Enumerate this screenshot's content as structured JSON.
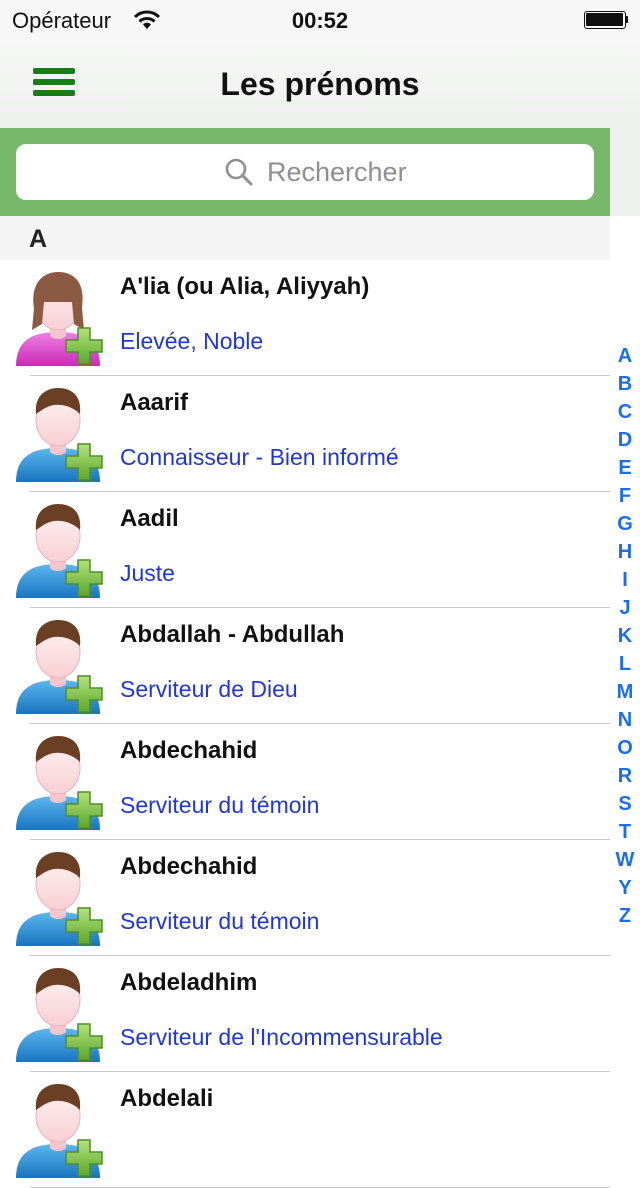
{
  "status_bar": {
    "carrier": "Opérateur",
    "time": "00:52"
  },
  "nav": {
    "title": "Les prénoms",
    "menu_icon": "hamburger-menu-icon"
  },
  "search": {
    "placeholder": "Rechercher"
  },
  "section": {
    "letter": "A"
  },
  "colors": {
    "accent_green": "#167d17",
    "search_bar_green": "#77b96b",
    "meaning_blue": "#2136d6",
    "index_blue": "#1a6ee8",
    "female_pink": "#e64fd2",
    "male_blue": "#2b8fd6",
    "plus_green": "#7ac143"
  },
  "names": [
    {
      "name": "A'lia (ou Alia, Aliyyah)",
      "meaning": "Elevée, Noble",
      "gender": "female"
    },
    {
      "name": "Aaarif",
      "meaning": "Connaisseur - Bien informé",
      "gender": "male"
    },
    {
      "name": "Aadil",
      "meaning": "Juste",
      "gender": "male"
    },
    {
      "name": "Abdallah - Abdullah",
      "meaning": "Serviteur de Dieu",
      "gender": "male"
    },
    {
      "name": "Abdechahid",
      "meaning": "Serviteur du témoin",
      "gender": "male"
    },
    {
      "name": "Abdechahid",
      "meaning": "Serviteur du témoin",
      "gender": "male"
    },
    {
      "name": "Abdeladhim",
      "meaning": "Serviteur de l'Incommensurable",
      "gender": "male"
    },
    {
      "name": "Abdelali",
      "meaning": "",
      "gender": "male"
    }
  ],
  "index": [
    "A",
    "B",
    "C",
    "D",
    "E",
    "F",
    "G",
    "H",
    "I",
    "J",
    "K",
    "L",
    "M",
    "N",
    "O",
    "R",
    "S",
    "T",
    "W",
    "Y",
    "Z"
  ]
}
